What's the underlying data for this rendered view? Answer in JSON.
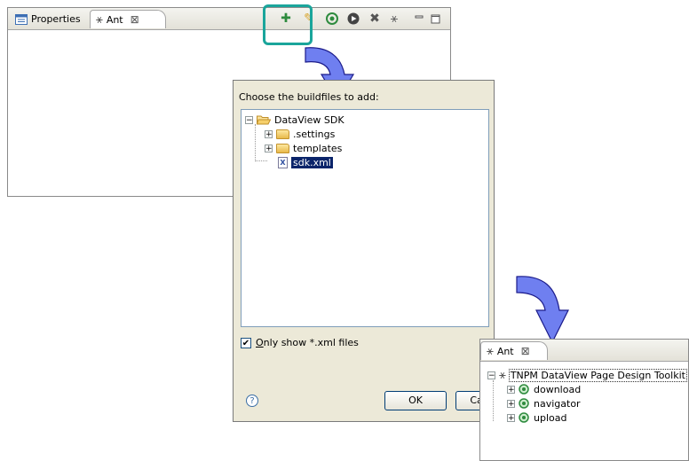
{
  "ant_view": {
    "tabs": [
      {
        "label": "Properties"
      },
      {
        "label": "Ant"
      }
    ],
    "toolbar_icons": [
      "add-buildfiles-icon",
      "add-with-search-icon",
      "run-target-icon",
      "run-icon",
      "remove-icon",
      "remove-all-icon",
      "minimize-icon",
      "maximize-icon"
    ]
  },
  "dialog": {
    "prompt_pre": "Choose the buildfiles to ",
    "prompt_post": "add:",
    "tree": {
      "root": "DataView SDK",
      "children": [
        ".settings",
        "templates",
        "sdk.xml"
      ]
    },
    "checkbox_label_u": "O",
    "checkbox_label_rest": "nly show *.xml files",
    "checkbox_checked": true,
    "ok_label": "OK",
    "cancel_label": "Cancel"
  },
  "result_view": {
    "tab_label": "Ant",
    "project": "TNPM DataView Page Design Toolkit",
    "targets": [
      "download",
      "navigator",
      "upload"
    ]
  },
  "colors": {
    "highlight": "#1aa59b",
    "arrow_fill": "#6f7ff0",
    "selection": "#0a246a"
  }
}
